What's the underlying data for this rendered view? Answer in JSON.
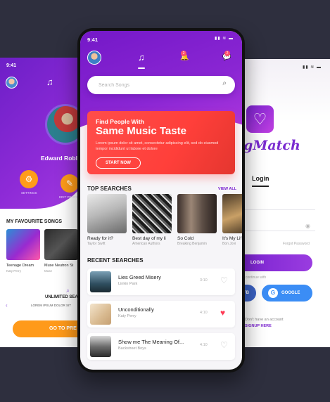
{
  "left": {
    "time": "9:41",
    "profile_name": "Edward Robl",
    "btn_settings": "SETTINGS",
    "btn_edit": "EDIT PROFILE",
    "fav_title": "MY FAVOURITE SONGS",
    "songs": [
      {
        "title": "Teenage Dream",
        "artist": "Katy Perry"
      },
      {
        "title": "Muse Neutron St",
        "artist": "Muse"
      }
    ],
    "unlimited": "UNLIMITED SEA",
    "desc": "LOREM IPSUM DOLOR SIT",
    "cta": "GO TO PRE"
  },
  "right": {
    "status": "▮▮ ≋ ▬",
    "logo_glyph": "♡",
    "brand": "gMatch",
    "login_title": "Login",
    "forgot": "Forgot Password",
    "login_btn": "LOGIN",
    "or_text": "Or continue with",
    "fb_btn": "FB",
    "google_btn": "GOOGLE",
    "google_glyph": "G",
    "noacct": "Don't have an account",
    "signup": "SIGNUP HERE"
  },
  "center": {
    "time": "9:41",
    "status": "▮▮ ≋ ▬",
    "nav": {
      "music_icon": "♫",
      "bell_icon": "🔔",
      "chat_icon": "💬",
      "bell_badge": "2",
      "chat_badge": "2"
    },
    "search": {
      "placeholder": "Search Songs",
      "icon": "⌕"
    },
    "promo": {
      "pre": "Find People With",
      "title": "Same Music Taste",
      "body": "Lorem ipsum dolor sit amet, consectetur adipiscing elit, sed do eiusmod tempor incididunt ut labore et dolore",
      "button": "START NOW"
    },
    "top_title": "TOP SEARCHES",
    "view_all": "VIEW ALL",
    "top": [
      {
        "title": "Ready for it?",
        "artist": "Taylor Swift"
      },
      {
        "title": "Best day of my li",
        "artist": "American Authors"
      },
      {
        "title": "So Cold",
        "artist": "Breaking Benjamin"
      },
      {
        "title": "It's My Lif",
        "artist": "Bon Jovi"
      }
    ],
    "recent_title": "RECENT SEARCHES",
    "recent": [
      {
        "title": "Lies Greed Misery",
        "artist": "Linkin Park",
        "duration": "3:10",
        "liked": "♡"
      },
      {
        "title": "Unconditionally",
        "artist": "Katy Perry",
        "duration": "4:10",
        "liked": "♥"
      },
      {
        "title": "Show me The Meaning Of...",
        "artist": "Backstreet Boys",
        "duration": "4:10",
        "liked": "♡"
      }
    ]
  }
}
